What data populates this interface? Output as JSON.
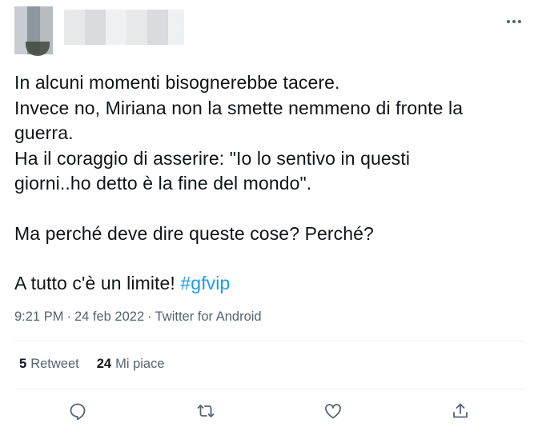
{
  "tweet": {
    "lines_para1": [
      "In alcuni momenti bisognerebbe tacere.",
      "Invece no, Miriana non la smette nemmeno di fronte la",
      "guerra.",
      "Ha il coraggio di asserire: \"Io lo sentivo in questi",
      "giorni..ho detto è la fine del mondo\"."
    ],
    "para2": "Ma perché deve dire queste cose? Perché?",
    "para3_text": "A tutto c'è un limite! ",
    "hashtag": "#gfvip"
  },
  "meta": {
    "time": "9:21 PM",
    "separator": "·",
    "date": "24 feb 2022",
    "client": "Twitter for Android"
  },
  "stats": {
    "retweets_count": "5",
    "retweets_label": "Retweet",
    "likes_count": "24",
    "likes_label": "Mi piace"
  },
  "icons": {
    "more": "more-dots-icon",
    "reply": "reply-icon",
    "retweet": "retweet-icon",
    "like": "heart-icon",
    "share": "share-icon"
  },
  "colors": {
    "text": "#0f1419",
    "secondary": "#536471",
    "link": "#1d9bf0",
    "divider": "#eff3f4"
  }
}
